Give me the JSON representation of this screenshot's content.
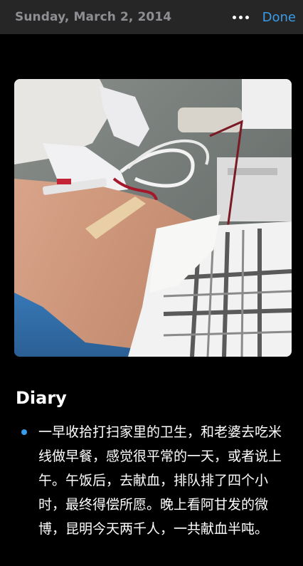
{
  "header": {
    "date": "Sunday, March 2, 2014",
    "more_icon": "ellipsis-icon",
    "done_label": "Done"
  },
  "photo": {
    "alt": "Photo of blood donation: arm with tape and tubing, gloved hands, blood bag equipment"
  },
  "diary": {
    "heading": "Diary",
    "bullets": [
      "一早收拾打扫家里的卫生，和老婆去吃米线做早餐，感觉很平常的一天，或者说上午。午饭后，去献血，排队排了四个小时，最终得偿所愿。晚上看阿甘发的微博，昆明今天两千人，一共献血半吨。"
    ]
  },
  "colors": {
    "accent": "#3a9ce8",
    "background": "#000000",
    "topbar": "#262626"
  }
}
